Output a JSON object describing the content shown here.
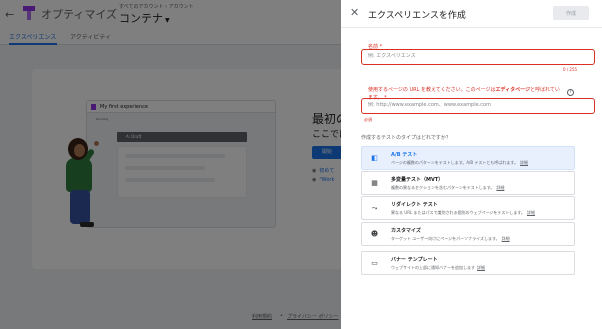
{
  "app": {
    "name": "オプティマイズ",
    "account_path": "すべてのアカウント › アカウント",
    "container_name": "コンテナ",
    "brand_color": "#9334e6"
  },
  "tabs": [
    {
      "label": "エクスペリエンス",
      "active": true
    },
    {
      "label": "アクティビティ",
      "active": false
    }
  ],
  "background": {
    "illustration_title": "My first experience",
    "illustration_sub": "Running",
    "illustration_bar": "A: Draft",
    "heading": "最初の",
    "subheading": "ここでは",
    "button_label": "開始",
    "links": [
      "初めて",
      "\"Work"
    ],
    "footer": {
      "terms": "利用規約",
      "privacy": "プライバシー ポリシー"
    }
  },
  "panel": {
    "title": "エクスペリエンスを作成",
    "create_label": "作成",
    "name_field": {
      "label": "名前",
      "required_mark": "*",
      "placeholder": "例: エクスペリエンス",
      "value": "",
      "counter": "0 / 255"
    },
    "url_field": {
      "label_prefix": "使用するページの URL を教えてください。このページは",
      "label_emphasis": "エディタページ",
      "label_suffix": "と呼ばれています。",
      "required_mark": "*",
      "placeholder": "例: http://www.example.com、www.example.com",
      "value": "",
      "error": "必須"
    },
    "types_question": "作成するテストのタイプはどれですか？",
    "detail_label": "詳細",
    "types": [
      {
        "title": "A/B テスト",
        "description": "ページの複数のパターンをテストします。A/B テストとも呼ばれます。",
        "icon": "ab-test-icon",
        "selected": true
      },
      {
        "title": "多変量テスト（MVT）",
        "description": "複数の異なるセクションを含むパターンをテストします。",
        "icon": "mvt-grid-icon",
        "selected": false
      },
      {
        "title": "リダイレクト テスト",
        "description": "異なる URL またはパスで識別される個別のウェブページをテストします。",
        "icon": "redirect-icon",
        "selected": false
      },
      {
        "title": "カスタマイズ",
        "description": "ターゲット ユーザー向けにページをパーソナライズします。",
        "icon": "person-customize-icon",
        "selected": false
      },
      {
        "title": "バナー テンプレート",
        "description": "ウェブサイトの上部に通知バナーを追加します",
        "icon": "banner-icon",
        "selected": false
      }
    ]
  },
  "colors": {
    "accent": "#1a73e8",
    "error": "#d93025",
    "selected_bg": "#e8f0fe"
  }
}
